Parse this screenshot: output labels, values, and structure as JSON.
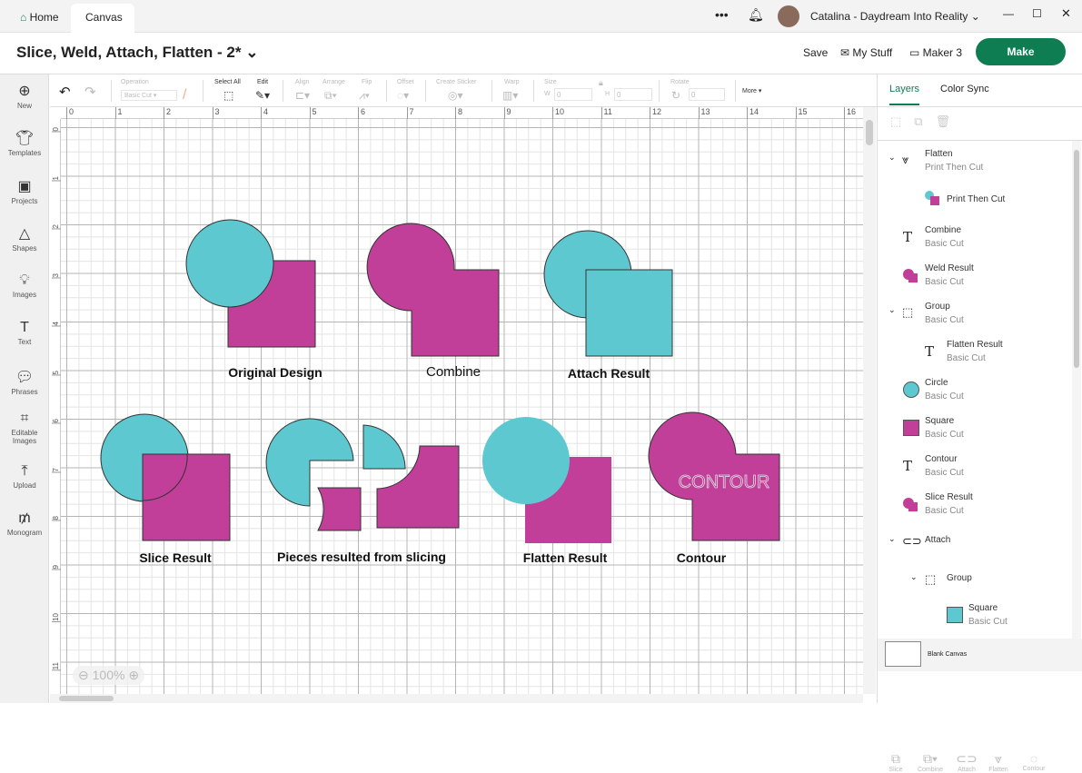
{
  "titlebar": {
    "tabs": [
      "Home",
      "Canvas"
    ],
    "user": "Catalina - Daydream Into Reality"
  },
  "header": {
    "title": "Slice, Weld, Attach, Flatten - 2*",
    "save": "Save",
    "my_stuff": "My Stuff",
    "machine": "Maker 3",
    "make": "Make"
  },
  "leftbar": [
    {
      "label": "New",
      "icon": "plus-icon"
    },
    {
      "label": "Templates",
      "icon": "shirt-icon"
    },
    {
      "label": "Projects",
      "icon": "projects-icon"
    },
    {
      "label": "Shapes",
      "icon": "shapes-icon"
    },
    {
      "label": "Images",
      "icon": "bulb-icon"
    },
    {
      "label": "Text",
      "icon": "text-icon"
    },
    {
      "label": "Phrases",
      "icon": "speech-icon"
    },
    {
      "label": "Editable Images",
      "icon": "edit-image-icon"
    },
    {
      "label": "Upload",
      "icon": "upload-icon"
    },
    {
      "label": "Monogram",
      "icon": "monogram-icon"
    }
  ],
  "toolbar": {
    "operation": "Operation",
    "operation_value": "Basic Cut",
    "select_all": "Select All",
    "edit": "Edit",
    "align": "Align",
    "arrange": "Arrange",
    "flip": "Flip",
    "offset": "Offset",
    "create_sticker": "Create Sticker",
    "warp": "Warp",
    "size": "Size",
    "w": "W",
    "h": "H",
    "w_value": "0",
    "h_value": "0",
    "rotate": "Rotate",
    "rotate_value": "0",
    "more": "More ▾"
  },
  "ruler": {
    "x": [
      "0",
      "1",
      "2",
      "3",
      "4",
      "5",
      "6",
      "7",
      "8",
      "9",
      "10",
      "11",
      "12",
      "13",
      "14",
      "15",
      "16"
    ],
    "y": [
      "0",
      "1",
      "2",
      "3",
      "4",
      "5",
      "6",
      "7",
      "8",
      "9",
      "10",
      "11"
    ]
  },
  "canvas": {
    "labels": {
      "original": "Original Design",
      "combine": "Combine",
      "attach": "Attach Result",
      "slice": "Slice Result",
      "pieces": "Pieces resulted from slicing",
      "flatten": "Flatten Result",
      "contour": "Contour",
      "contour_text": "CONTOUR"
    },
    "zoom": "100%",
    "colors": {
      "teal": "#5ec8d0",
      "magenta": "#c13e99"
    }
  },
  "panel": {
    "tabs": [
      "Layers",
      "Color Sync"
    ],
    "layers": [
      {
        "name": "Flatten",
        "sub": "Print Then Cut"
      },
      {
        "name": "Print Then Cut",
        "sub": ""
      },
      {
        "name": "Combine",
        "sub": "Basic Cut"
      },
      {
        "name": "Weld Result",
        "sub": "Basic Cut"
      },
      {
        "name": "Group",
        "sub": "Basic Cut"
      },
      {
        "name": "Flatten Result",
        "sub": "Basic Cut"
      },
      {
        "name": "Circle",
        "sub": "Basic Cut"
      },
      {
        "name": "Square",
        "sub": "Basic Cut"
      },
      {
        "name": "Contour",
        "sub": "Basic Cut"
      },
      {
        "name": "Slice Result",
        "sub": "Basic Cut"
      },
      {
        "name": "Attach",
        "sub": ""
      },
      {
        "name": "Group",
        "sub": ""
      },
      {
        "name": "Square",
        "sub": "Basic Cut"
      }
    ],
    "blank_canvas": "Blank Canvas",
    "bottom": [
      "Slice",
      "Combine",
      "Attach",
      "Flatten",
      "Contour"
    ]
  }
}
